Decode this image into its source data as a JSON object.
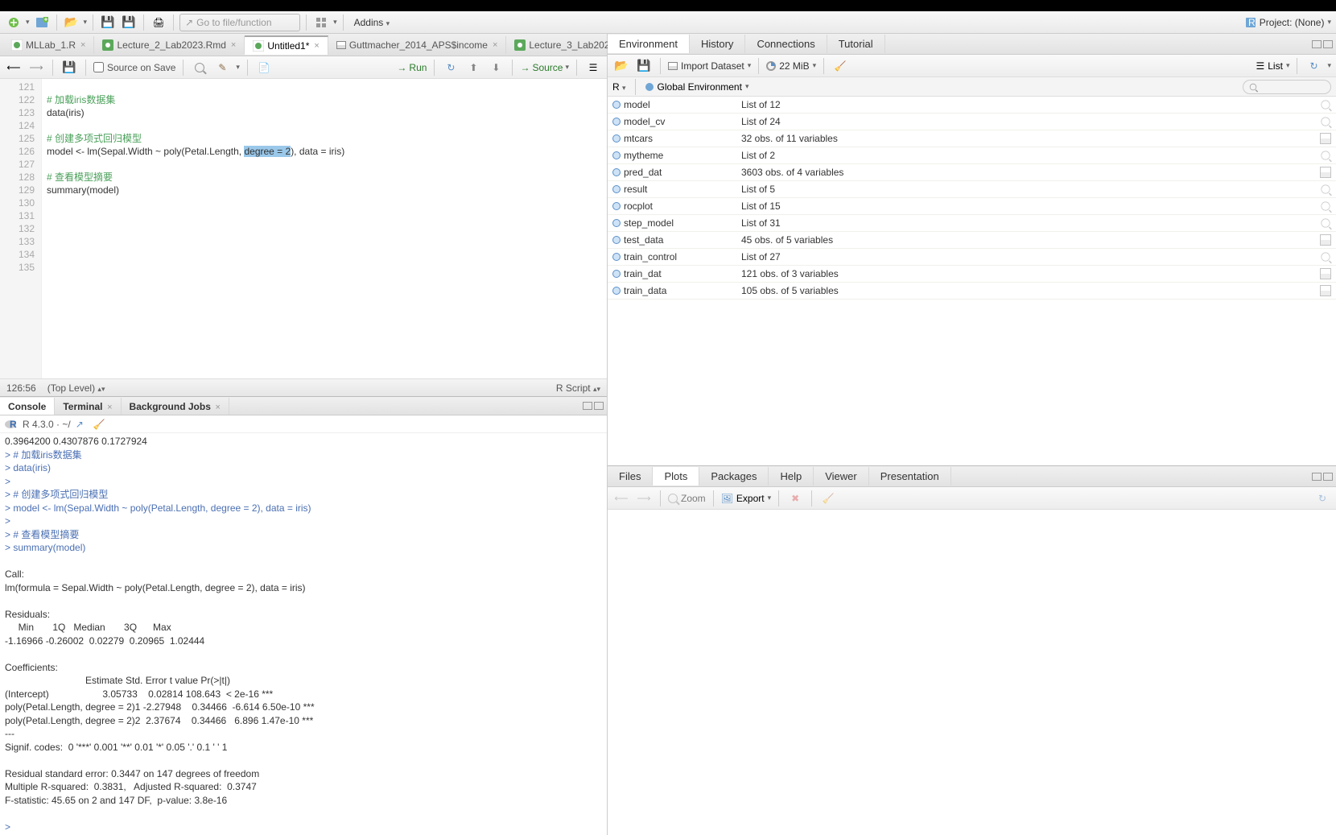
{
  "toolbar": {
    "goto_placeholder": "Go to file/function",
    "addins": "Addins",
    "project": "Project: (None)"
  },
  "editor_tabs": [
    {
      "label": "MLLab_1.R",
      "icon": "r"
    },
    {
      "label": "Lecture_2_Lab2023.Rmd",
      "icon": "rmd"
    },
    {
      "label": "Untitled1*",
      "icon": "r",
      "active": true
    },
    {
      "label": "Guttmacher_2014_APS$income",
      "icon": "data"
    },
    {
      "label": "Lecture_3_Lab202",
      "icon": "rmd"
    }
  ],
  "source_toolbar": {
    "source_on_save": "Source on Save",
    "run": "Run",
    "source": "Source"
  },
  "code_lines": [
    {
      "n": "121",
      "segs": [
        {
          "t": ""
        }
      ]
    },
    {
      "n": "122",
      "segs": [
        {
          "t": "# 加载iris数据集",
          "cls": "c-comment"
        }
      ]
    },
    {
      "n": "123",
      "segs": [
        {
          "t": "data(iris)"
        }
      ]
    },
    {
      "n": "124",
      "segs": [
        {
          "t": ""
        }
      ]
    },
    {
      "n": "125",
      "segs": [
        {
          "t": "# 创建多项式回归模型",
          "cls": "c-comment"
        }
      ]
    },
    {
      "n": "126",
      "segs": [
        {
          "t": "model <- lm(Sepal.Width ~ poly(Petal.Length, "
        },
        {
          "t": "degree = 2",
          "cls": "hl"
        },
        {
          "t": "), data = iris)"
        }
      ]
    },
    {
      "n": "127",
      "segs": [
        {
          "t": ""
        }
      ]
    },
    {
      "n": "128",
      "segs": [
        {
          "t": "# 查看模型摘要",
          "cls": "c-comment"
        }
      ]
    },
    {
      "n": "129",
      "segs": [
        {
          "t": "summary(model)"
        }
      ]
    },
    {
      "n": "130",
      "segs": [
        {
          "t": ""
        }
      ]
    },
    {
      "n": "131",
      "segs": [
        {
          "t": ""
        }
      ]
    },
    {
      "n": "132",
      "segs": [
        {
          "t": ""
        }
      ]
    },
    {
      "n": "133",
      "segs": [
        {
          "t": ""
        }
      ]
    },
    {
      "n": "134",
      "segs": [
        {
          "t": ""
        }
      ]
    },
    {
      "n": "135",
      "segs": [
        {
          "t": ""
        }
      ]
    }
  ],
  "editor_status": {
    "pos": "126:56",
    "scope": "(Top Level)",
    "type": "R Script"
  },
  "console_tabs": [
    {
      "label": "Console",
      "active": true
    },
    {
      "label": "Terminal"
    },
    {
      "label": "Background Jobs"
    }
  ],
  "console": {
    "header": "R 4.3.0 · ~/",
    "lines": [
      "0.3964200 0.4307876 0.1727924",
      "> # 加载iris数据集",
      "> data(iris)",
      "> ",
      "> # 创建多项式回归模型",
      "> model <- lm(Sepal.Width ~ poly(Petal.Length, degree = 2), data = iris)",
      "> ",
      "> # 查看模型摘要",
      "> summary(model)",
      "",
      "Call:",
      "lm(formula = Sepal.Width ~ poly(Petal.Length, degree = 2), data = iris)",
      "",
      "Residuals:",
      "     Min       1Q   Median       3Q      Max ",
      "-1.16966 -0.26002  0.02279  0.20965  1.02444 ",
      "",
      "Coefficients:",
      "                              Estimate Std. Error t value Pr(>|t|)    ",
      "(Intercept)                    3.05733    0.02814 108.643  < 2e-16 ***",
      "poly(Petal.Length, degree = 2)1 -2.27948    0.34466  -6.614 6.50e-10 ***",
      "poly(Petal.Length, degree = 2)2  2.37674    0.34466   6.896 1.47e-10 ***",
      "---",
      "Signif. codes:  0 '***' 0.001 '**' 0.01 '*' 0.05 '.' 0.1 ' ' 1",
      "",
      "Residual standard error: 0.3447 on 147 degrees of freedom",
      "Multiple R-squared:  0.3831,\tAdjusted R-squared:  0.3747 ",
      "F-statistic: 45.65 on 2 and 147 DF,  p-value: 3.8e-16",
      "",
      "> "
    ]
  },
  "env": {
    "tabs": [
      "Environment",
      "History",
      "Connections",
      "Tutorial"
    ],
    "active_tab": "Environment",
    "import": "Import Dataset",
    "mem": "22 MiB",
    "list": "List",
    "lang": "R",
    "scope": "Global Environment",
    "items": [
      {
        "name": "model",
        "val": "List of  12",
        "kind": "list"
      },
      {
        "name": "model_cv",
        "val": "List of  24",
        "kind": "list"
      },
      {
        "name": "mtcars",
        "val": "32 obs. of 11 variables",
        "kind": "data"
      },
      {
        "name": "mytheme",
        "val": "List of  2",
        "kind": "list"
      },
      {
        "name": "pred_dat",
        "val": "3603 obs. of 4 variables",
        "kind": "data"
      },
      {
        "name": "result",
        "val": "List of  5",
        "kind": "list"
      },
      {
        "name": "rocplot",
        "val": "List of  15",
        "kind": "list"
      },
      {
        "name": "step_model",
        "val": "List of  31",
        "kind": "list"
      },
      {
        "name": "test_data",
        "val": "45 obs. of 5 variables",
        "kind": "data"
      },
      {
        "name": "train_control",
        "val": "List of  27",
        "kind": "list"
      },
      {
        "name": "train_dat",
        "val": "121 obs. of 3 variables",
        "kind": "data"
      },
      {
        "name": "train_data",
        "val": "105 obs. of 5 variables",
        "kind": "data"
      }
    ]
  },
  "files_tabs": [
    "Files",
    "Plots",
    "Packages",
    "Help",
    "Viewer",
    "Presentation"
  ],
  "files_active": "Plots",
  "plots_toolbar": {
    "zoom": "Zoom",
    "export": "Export"
  }
}
